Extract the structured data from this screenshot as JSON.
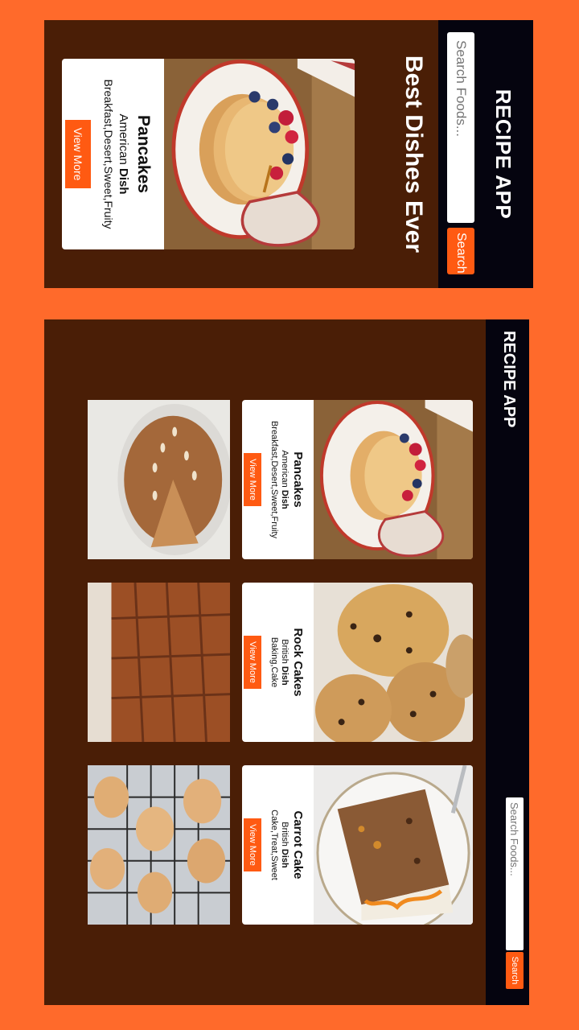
{
  "app": {
    "brand": "RECIPE APP",
    "hero_title": "Best Dishes Ever"
  },
  "search": {
    "placeholder": "Search Foods...",
    "button_label": "Search"
  },
  "recipes": [
    {
      "title": "Pancakes",
      "cuisine": "American",
      "dish_label": "Dish",
      "tags": "Breakfast,Desert,Sweet,Fruity",
      "button_label": "View More"
    },
    {
      "title": "Rock Cakes",
      "cuisine": "British",
      "dish_label": "Dish",
      "tags": "Baking,Cake",
      "button_label": "View More"
    },
    {
      "title": "Carrot Cake",
      "cuisine": "British",
      "dish_label": "Dish",
      "tags": "Cake,Treat,Sweet",
      "button_label": "View More"
    }
  ],
  "colors": {
    "page_bg": "#ff6a2b",
    "screen_bg": "#4a1e06",
    "navbar": "#05040f",
    "accent": "#ff5a12"
  }
}
